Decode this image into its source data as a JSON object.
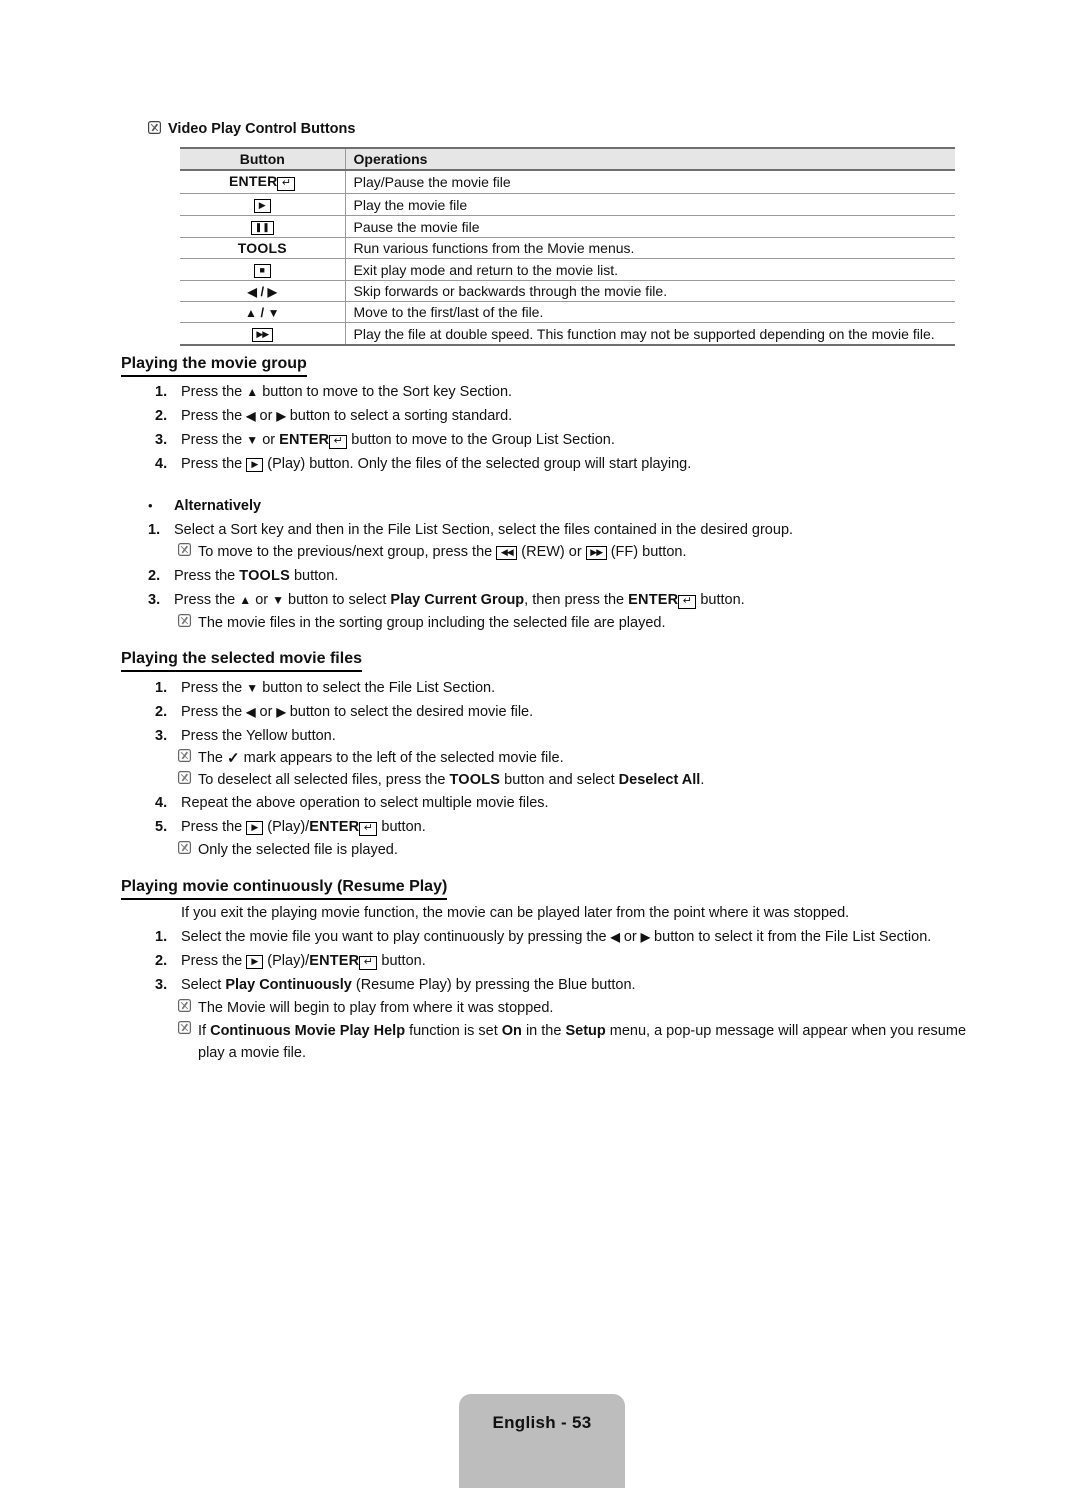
{
  "document": {
    "note_icon_name": "note-pencil-icon",
    "top_note_label": "Video Play Control Buttons"
  },
  "table": {
    "headers": {
      "button": "Button",
      "operations": "Operations"
    },
    "rows": [
      {
        "button_text": "ENTER",
        "button_glyph": "enter",
        "operation": "Play/Pause the movie file"
      },
      {
        "button_text": "",
        "button_glyph": "play",
        "operation": "Play the movie file"
      },
      {
        "button_text": "",
        "button_glyph": "pause",
        "operation": "Pause the movie file"
      },
      {
        "button_text": "TOOLS",
        "button_glyph": "text",
        "operation": "Run various functions from the Movie menus."
      },
      {
        "button_text": "",
        "button_glyph": "stop",
        "operation": "Exit play mode and return to the movie list."
      },
      {
        "button_text": "",
        "button_glyph": "left-right",
        "operation": "Skip forwards or backwards through the movie file."
      },
      {
        "button_text": "",
        "button_glyph": "up-down",
        "operation": "Move to the first/last of the file."
      },
      {
        "button_text": "",
        "button_glyph": "ff",
        "operation": "Play the file at double speed. This function may not be supported depending on the movie file."
      }
    ]
  },
  "section_movie_group": {
    "heading": "Playing the movie group",
    "step1_a": "Press the ",
    "step1_b": " button to move to the Sort key Section.",
    "step2_a": "Press the ",
    "step2_mid": " or ",
    "step2_b": " button to select a sorting standard.",
    "step3_a": "Press the ",
    "step3_mid": " or ",
    "step3_enter": "ENTER",
    "step3_b": " button to move to the Group List Section.",
    "step4_a": "Press the ",
    "step4_b": " (Play) button. Only the files of the selected group will start playing.",
    "nums": [
      "1.",
      "2.",
      "3.",
      "4."
    ]
  },
  "section_alternatively": {
    "bullet": "•",
    "label": "Alternatively",
    "alt1": "Select a Sort key and then in the File List Section, select the files contained in the desired group.",
    "alt1_note_a": "To move to the previous/next group, press the ",
    "alt1_note_rew": " (REW) or ",
    "alt1_note_ff": " (FF) button.",
    "alt2_a": "Press the ",
    "alt2_tools": "TOOLS",
    "alt2_b": " button.",
    "alt3_a": "Press the ",
    "alt3_mid": " or ",
    "alt3_b": " button to select ",
    "alt3_bold": "Play Current Group",
    "alt3_c": ", then press the ",
    "alt3_enter": "ENTER",
    "alt3_d": " button.",
    "alt3_note": "The movie files in the sorting group including the selected file are played.",
    "nums": [
      "1.",
      "2.",
      "3."
    ]
  },
  "section_selected_files": {
    "heading": "Playing the selected movie files",
    "step1_a": "Press the ",
    "step1_b": " button to select the File List Section.",
    "step2_a": "Press the ",
    "step2_mid": " or ",
    "step2_b": " button to select the desired movie file.",
    "step3": "Press the Yellow button.",
    "step3_note_a": "The ",
    "step3_note_b": " mark appears to the left of the selected movie file.",
    "step3_note2_a": "To deselect all selected files, press the ",
    "step3_note2_tools": "TOOLS",
    "step3_note2_b": " button and select ",
    "step3_note2_bold": "Deselect All",
    "step3_note2_c": ".",
    "step4": "Repeat the above operation to select multiple movie files.",
    "step5_a": "Press the ",
    "step5_b": " (Play)/",
    "step5_enter": "ENTER",
    "step5_c": " button.",
    "step5_note": "Only the selected file is played.",
    "nums": [
      "1.",
      "2.",
      "3.",
      "4.",
      "5."
    ]
  },
  "section_resume_play": {
    "heading": "Playing movie continuously (Resume Play)",
    "intro": "If you exit the playing movie function, the movie can be played later from the point where it was stopped.",
    "step1_a": "Select the movie file you want to play continuously by pressing the ",
    "step1_mid": " or ",
    "step1_b": " button to select it from the File List Section.",
    "step2_a": "Press the ",
    "step2_b": " (Play)/",
    "step2_enter": "ENTER",
    "step2_c": " button.",
    "step3_a": "Select ",
    "step3_bold": "Play Continuously",
    "step3_b": " (Resume Play) by pressing the Blue button.",
    "step3_note1": "The Movie will begin to play from where it was stopped.",
    "step3_note2_a": "If ",
    "step3_note2_bold1": "Continuous Movie Play Help",
    "step3_note2_b": " function is set ",
    "step3_note2_bold2": "On",
    "step3_note2_c": " in the ",
    "step3_note2_bold3": "Setup",
    "step3_note2_d": " menu, a pop-up message will appear when you resume",
    "step3_note2_e": "play a movie file.",
    "nums": [
      "1.",
      "2.",
      "3."
    ]
  },
  "footer": {
    "page_label": "English - 53"
  },
  "colors": {
    "table_header_bg": "#e6e6e6",
    "table_border": "#9a9a9a",
    "table_border_dark": "#6f6f6f",
    "footer_badge_bg": "#bdbdbd",
    "text": "#111111"
  }
}
